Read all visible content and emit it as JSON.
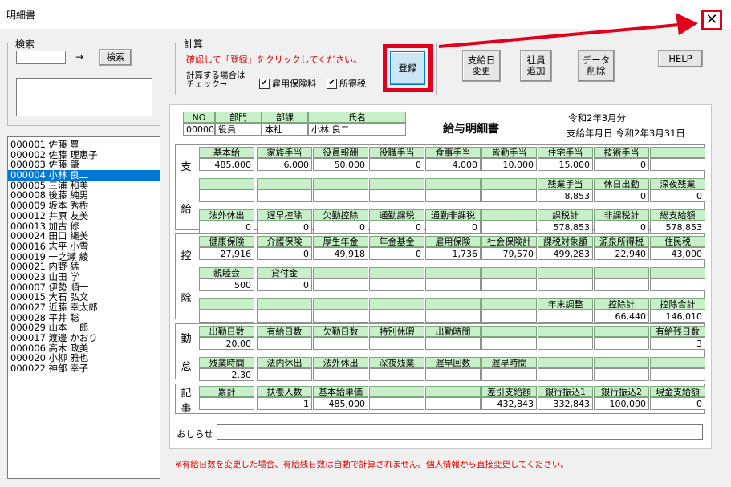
{
  "window": {
    "title": "明細書",
    "close_glyph": "✕"
  },
  "search": {
    "group_title": "検索",
    "arrow": "→",
    "button": "検索",
    "employees": [
      "000001 佐藤 豊",
      "000002 佐藤 理恵子",
      "000003 佐藤 肇",
      "000004 小林 良二",
      "000005 三浦 和美",
      "000008 後藤 純男",
      "000009 坂本 秀樹",
      "000012 井原 友美",
      "000013 加古 修",
      "000024 田口 縄美",
      "000016 志平 小雪",
      "000019 一之瀬 綾",
      "000021 内野 猛",
      "000023 山田 学",
      "000007 伊勢 順一",
      "000015 大石 弘文",
      "000027 近藤 幸太郎",
      "000028 平井 聡",
      "000029 山本 一郎",
      "000017 渡邊 かおり",
      "000006 髙木 政美",
      "000020 小柳 雅也",
      "000022 神部 幸子"
    ],
    "selected_index": 3
  },
  "calc": {
    "group_title": "計算",
    "instruction": "確認して「登録」をクリックしてください。",
    "check_hint_1": "計算する場合は",
    "check_hint_2": "チェック→",
    "cb_employment": "雇用保険料",
    "cb_income_tax": "所得税",
    "register": "登録"
  },
  "buttons": {
    "pay_date_change_1": "支給日",
    "pay_date_change_2": "変更",
    "add_employee_1": "社員",
    "add_employee_2": "追加",
    "delete_data_1": "データ",
    "delete_data_2": "削除",
    "help": "HELP"
  },
  "slip": {
    "title": "給与明細書",
    "period": "令和2年3月分",
    "pay_date": "支給年月日 令和2年3月31日",
    "header_labels": [
      "NO",
      "部門",
      "部課",
      "氏名"
    ],
    "header_values": [
      "000004",
      "役員",
      "本社",
      "小林 良二"
    ],
    "pay_side": [
      "支",
      "給"
    ],
    "pay_row1_labels": [
      "基本給",
      "家族手当",
      "役員報酬",
      "役職手当",
      "食事手当",
      "皆勤手当",
      "住宅手当",
      "技術手当",
      ""
    ],
    "pay_row1_values": [
      "485,000",
      "6,000",
      "50,000",
      "0",
      "4,000",
      "10,000",
      "15,000",
      "0",
      ""
    ],
    "pay_row2_labels": [
      "",
      "",
      "",
      "",
      "",
      "",
      "残業手当",
      "休日出勤",
      "深夜残業"
    ],
    "pay_row2_values": [
      "",
      "",
      "",
      "",
      "",
      "",
      "8,853",
      "0",
      "0"
    ],
    "pay_row3_labels": [
      "法外休出",
      "遅早控除",
      "欠勤控除",
      "通勤課税",
      "通勤非課税",
      "",
      "課税計",
      "非課税計",
      "総支給額"
    ],
    "pay_row3_values": [
      "0",
      "0",
      "0",
      "0",
      "0",
      "",
      "578,853",
      "0",
      "578,853"
    ],
    "ded_side": [
      "控",
      "除"
    ],
    "ded_row1_labels": [
      "健康保険",
      "介護保険",
      "厚生年金",
      "年金基金",
      "雇用保険",
      "社会保険計",
      "課税対象額",
      "源泉所得税",
      "住民税"
    ],
    "ded_row1_values": [
      "27,916",
      "0",
      "49,918",
      "0",
      "1,736",
      "79,570",
      "499,283",
      "22,940",
      "43,000"
    ],
    "ded_row2_labels": [
      "親睦会",
      "貸付金",
      "",
      "",
      "",
      "",
      "",
      "",
      ""
    ],
    "ded_row2_values": [
      "500",
      "0",
      "",
      "",
      "",
      "",
      "",
      "",
      ""
    ],
    "ded_row3_labels": [
      "",
      "",
      "",
      "",
      "",
      "",
      "年末調整",
      "控除計",
      "控除合計"
    ],
    "ded_row3_values": [
      "",
      "",
      "",
      "",
      "",
      "",
      "",
      "66,440",
      "146,010"
    ],
    "att_side": [
      "勤",
      "怠"
    ],
    "att_row1_labels": [
      "出勤日数",
      "有給日数",
      "欠勤日数",
      "特別休暇",
      "出勤時間",
      "",
      "",
      "",
      "有給残日数"
    ],
    "att_row1_values": [
      "20.00",
      "",
      "",
      "",
      "",
      "",
      "",
      "",
      "3"
    ],
    "att_row2_labels": [
      "残業時間",
      "法内休出",
      "法外休出",
      "深夜残業",
      "遅早回数",
      "遅早時間",
      "",
      "",
      ""
    ],
    "att_row2_values": [
      "2.30",
      "",
      "",
      "",
      "",
      "",
      "",
      "",
      ""
    ],
    "rec_side": [
      "記",
      "事"
    ],
    "rec_labels": [
      "累計",
      "扶養人数",
      "基本給単価",
      "",
      "",
      "差引支給額",
      "銀行振込1",
      "銀行振込2",
      "現金支給額"
    ],
    "rec_values": [
      "",
      "1",
      "485,000",
      "",
      "",
      "432,843",
      "332,843",
      "100,000",
      "0"
    ],
    "notice_label": "おしらせ"
  },
  "footer_note": "※有給日数を変更した場合、有給残日数は自動で計算されません。個人情報から直接変更してください。",
  "colors": {
    "accent_red": "#e0001b",
    "label_green": "#c8f0c8",
    "selection_blue": "#0078d7"
  }
}
